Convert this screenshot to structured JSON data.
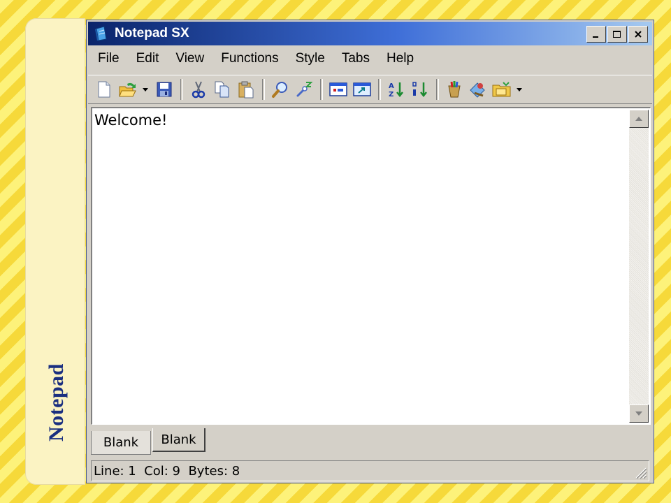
{
  "side_panel": {
    "title": "Notepad"
  },
  "window": {
    "title": "Notepad SX",
    "icon": "notepad-app-icon",
    "controls": [
      "minimize-icon",
      "maximize-icon",
      "close-icon"
    ]
  },
  "menu": {
    "items": [
      "File",
      "Edit",
      "View",
      "Functions",
      "Style",
      "Tabs",
      "Help"
    ]
  },
  "toolbar": {
    "buttons": [
      "new-file-icon",
      "open-file-icon",
      "save-icon",
      "cut-icon",
      "copy-icon",
      "paste-icon",
      "find-icon",
      "replace-icon",
      "window-icon",
      "open-window-icon",
      "sort-ascending-icon",
      "sort-descending-icon",
      "paint-icon",
      "tool-icon",
      "folder-icon"
    ]
  },
  "editor": {
    "content": "Welcome!"
  },
  "tabs": [
    {
      "label": "Blank"
    },
    {
      "label": "Blank"
    }
  ],
  "status": {
    "text": "Line: 1  Col: 9  Bytes: 8"
  },
  "colors": {
    "title_gradient_start": "#0a246a",
    "title_gradient_end": "#a6caf0",
    "chrome": "#d4d0c8",
    "side_title": "#1a2f80",
    "background": "#fbe65a"
  }
}
